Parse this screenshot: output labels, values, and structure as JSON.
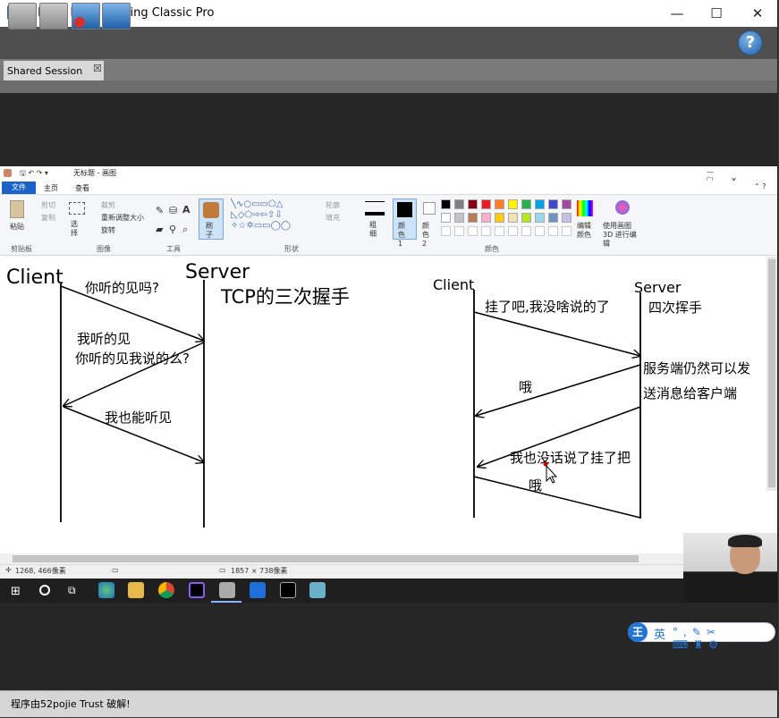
{
  "window": {
    "title": "Inletex Easy Meeting Classic Pro",
    "min": "—",
    "max": "☐",
    "close": "✕"
  },
  "toolbar": {
    "help_label": "?"
  },
  "tabs": [
    {
      "label": "Shared Session",
      "close": "☒"
    }
  ],
  "paint": {
    "title": "无标题 - 画图",
    "tabs": [
      "文件",
      "主页",
      "查看"
    ],
    "groups": [
      "剪贴板",
      "图像",
      "工具",
      "形状",
      "颜色"
    ],
    "clipboard": {
      "paste": "粘贴",
      "cut": "剪切",
      "copy": "复制"
    },
    "image": {
      "select": "选择",
      "crop": "裁剪",
      "resize": "重新调整大小",
      "rotate": "旋转"
    },
    "brush": "刷子",
    "shape_opts": {
      "outline": "轮廓",
      "fill": "填充"
    },
    "size": "粗细",
    "color1": "颜色 1",
    "color2": "颜色 2",
    "edit_colors": "编辑颜色",
    "paint3d": "使用画图 3D 进行编辑",
    "palette": [
      "#000000",
      "#7f7f7f",
      "#880015",
      "#ed1c24",
      "#ff7f27",
      "#fff200",
      "#22b14c",
      "#00a2e8",
      "#3f48cc",
      "#a349a4",
      "#ffffff",
      "#c3c3c3",
      "#b97a57",
      "#ffaec9",
      "#ffc90e",
      "#efe4b0",
      "#b5e61d",
      "#99d9ea",
      "#7092be",
      "#c8bfe7"
    ],
    "status": {
      "cursor": "1268, 466像素",
      "size": "1857 × 738像素"
    }
  },
  "diagram": {
    "left": {
      "client": "Client",
      "server": "Server",
      "title": "TCP的三次握手",
      "m1": "你听的见吗?",
      "m2a": "我听的见",
      "m2b": "你听的见我说的么?",
      "m3": "我也能听见"
    },
    "right": {
      "client": "Client",
      "server": "Server",
      "title": "四次挥手",
      "m1": "挂了吧,我没啥说的了",
      "m2": "哦",
      "m3a": "服务端仍然可以发",
      "m3b": "送消息给客户端",
      "m4": "我也没话说了挂了把",
      "m5": "哦"
    }
  },
  "taskbar": {
    "icons": [
      "windows-start-icon",
      "search-circle-icon",
      "task-view-icon",
      "edge-icon",
      "file-explorer-icon",
      "chrome-icon",
      "intellij-icon",
      "paint-icon",
      "pycharm-icon",
      "terminal-icon",
      "notepad-icon"
    ]
  },
  "ime": {
    "logo": "王",
    "lang": "英"
  },
  "statusbar": {
    "text": "程序由52pojie Trust 破解!"
  }
}
